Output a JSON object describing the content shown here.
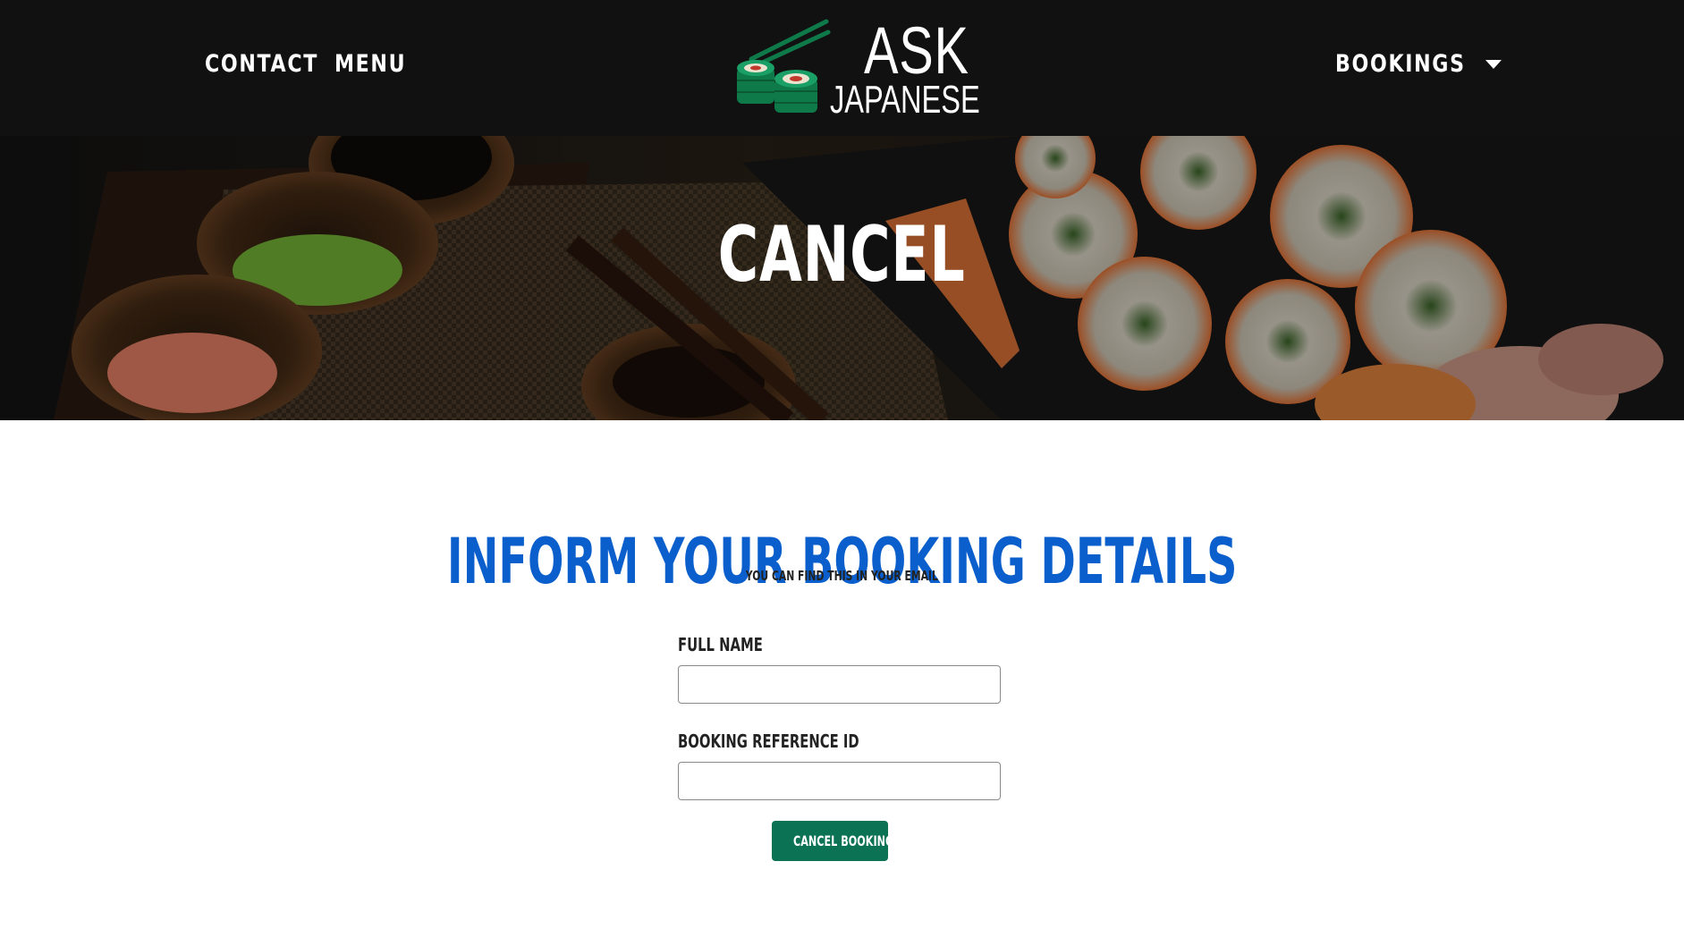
{
  "header": {
    "nav_left": [
      {
        "label": "CONTACT"
      },
      {
        "label": "MENU"
      }
    ],
    "logo": {
      "line1": "ASK",
      "line2": "JAPANESE"
    },
    "nav_right": {
      "label": "BOOKINGS"
    }
  },
  "hero": {
    "title": "CANCEL"
  },
  "main": {
    "heading": "INFORM YOUR BOOKING DETAILS",
    "subheading": "YOU CAN FIND THIS IN YOUR EMAIL",
    "fields": [
      {
        "label": "FULL NAME",
        "value": "",
        "placeholder": ""
      },
      {
        "label": "BOOKING REFERENCE ID",
        "value": "",
        "placeholder": ""
      }
    ],
    "submit_label": "CANCEL BOOKING"
  },
  "colors": {
    "header_bg": "#111111",
    "heading_blue": "#0a5fcc",
    "button_green": "#0b7254",
    "logo_green": "#0e7a4a"
  }
}
